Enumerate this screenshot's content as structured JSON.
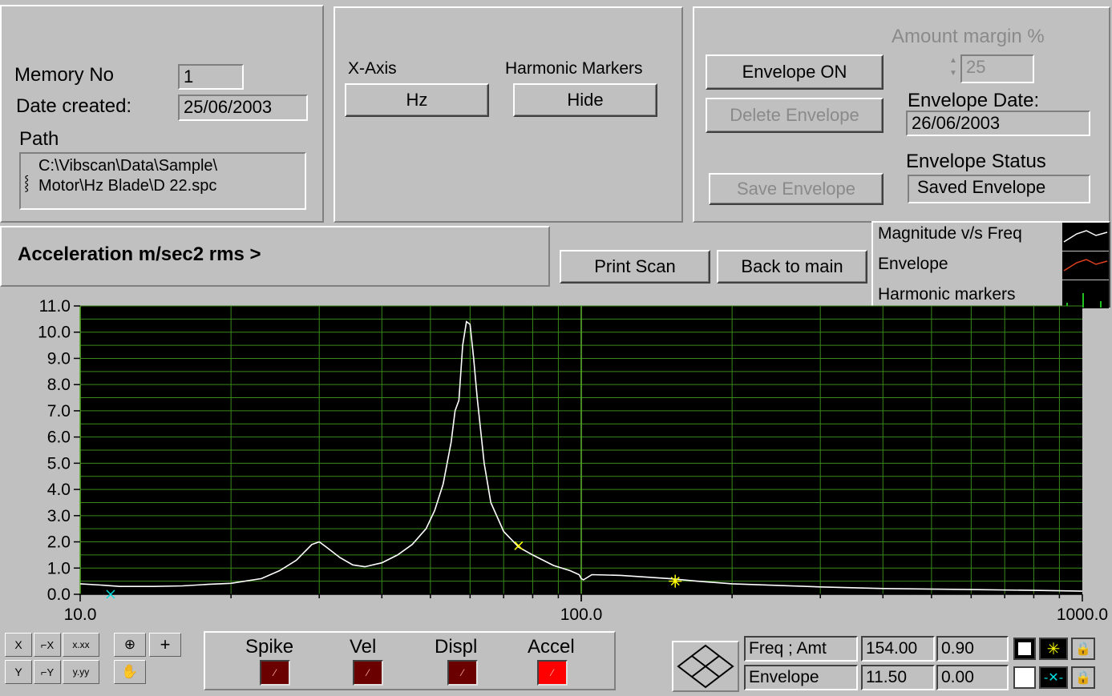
{
  "file_panel": {
    "memory_label": "Memory No",
    "memory_value": "1",
    "date_label": "Date created:",
    "date_value": "25/06/2003",
    "path_label": "Path",
    "path_line1": "C:\\Vibscan\\Data\\Sample\\",
    "path_line2": "Motor\\Hz Blade\\D 22.spc"
  },
  "axis_panel": {
    "xaxis_label": "X-Axis",
    "xaxis_button": "Hz",
    "harmonic_label": "Harmonic Markers",
    "harmonic_button": "Hide"
  },
  "envelope_panel": {
    "envelope_on_button": "Envelope ON",
    "delete_button": "Delete Envelope",
    "save_button": "Save Envelope",
    "margin_label": "Amount margin %",
    "margin_value": "25",
    "date_label": "Envelope Date:",
    "date_value": "26/06/2003",
    "status_label": "Envelope Status",
    "status_value": "Saved Envelope"
  },
  "units_label": "Acceleration m/sec2 rms >",
  "actions": {
    "print_button": "Print Scan",
    "back_button": "Back to main"
  },
  "legend": [
    {
      "label": "Magnitude v/s Freq",
      "color": "#ffffff"
    },
    {
      "label": "Envelope",
      "color": "#e04020"
    },
    {
      "label": "Harmonic markers",
      "color": "#20c020"
    }
  ],
  "modes": [
    {
      "label": "Spike",
      "active": false
    },
    {
      "label": "Vel",
      "active": false
    },
    {
      "label": "Displ",
      "active": false
    },
    {
      "label": "Accel",
      "active": true
    }
  ],
  "palette_icons": [
    "x-scale-icon",
    "x-format-icon",
    "zoom-icon",
    "crosshair-icon",
    "y-scale-icon",
    "y-format-icon",
    "pan-hand-icon"
  ],
  "palette_text": {
    "x_format": "x.xx",
    "y_format": "y.yy",
    "x_scale": "X",
    "y_scale": "Y"
  },
  "cursors": [
    {
      "name": "Freq ; Amt",
      "x": "154.00",
      "y": "0.90",
      "color": "#ffff00"
    },
    {
      "name": "Envelope",
      "x": "11.50",
      "y": "0.00",
      "color": "#00e0e0"
    }
  ],
  "chart_data": {
    "type": "line",
    "xscale": "log",
    "xlim": [
      10,
      1000
    ],
    "ylim": [
      0,
      11
    ],
    "xticks": [
      "10.0",
      "100.0",
      "1000.0"
    ],
    "yticks": [
      "0.0",
      "1.0",
      "2.0",
      "3.0",
      "4.0",
      "5.0",
      "6.0",
      "7.0",
      "8.0",
      "9.0",
      "10.0",
      "11.0"
    ],
    "background": "#000000",
    "grid": true,
    "grid_color": "#3a8a1a",
    "series": [
      {
        "color": "#ffffff",
        "x": [
          10,
          11,
          12,
          14,
          16,
          18,
          20,
          23,
          25,
          27,
          29,
          30,
          31,
          33,
          35,
          37,
          40,
          43,
          46,
          49,
          51,
          53,
          55,
          56,
          57,
          58,
          59,
          60,
          61,
          62,
          64,
          66,
          70,
          75,
          80,
          88,
          95,
          99,
          100,
          101,
          105,
          120,
          150,
          170,
          200,
          300,
          400,
          600,
          800,
          1000
        ],
        "y": [
          0.4,
          0.35,
          0.3,
          0.3,
          0.32,
          0.38,
          0.42,
          0.6,
          0.9,
          1.3,
          1.9,
          2.0,
          1.8,
          1.4,
          1.12,
          1.05,
          1.2,
          1.5,
          1.9,
          2.5,
          3.2,
          4.2,
          5.8,
          7.0,
          7.4,
          9.5,
          10.4,
          10.3,
          9.0,
          7.5,
          5.0,
          3.5,
          2.4,
          1.8,
          1.5,
          1.1,
          0.9,
          0.75,
          0.6,
          0.55,
          0.75,
          0.72,
          0.6,
          0.5,
          0.4,
          0.28,
          0.22,
          0.18,
          0.15,
          0.12
        ]
      }
    ],
    "markers": [
      {
        "x": 75,
        "y": 1.85,
        "color": "#ffff00",
        "symbol": "x"
      },
      {
        "x": 154,
        "y": 0.5,
        "color": "#ffff00",
        "symbol": "star"
      },
      {
        "x": 11.5,
        "y": 0.0,
        "color": "#00e0e0",
        "symbol": "x"
      }
    ]
  }
}
